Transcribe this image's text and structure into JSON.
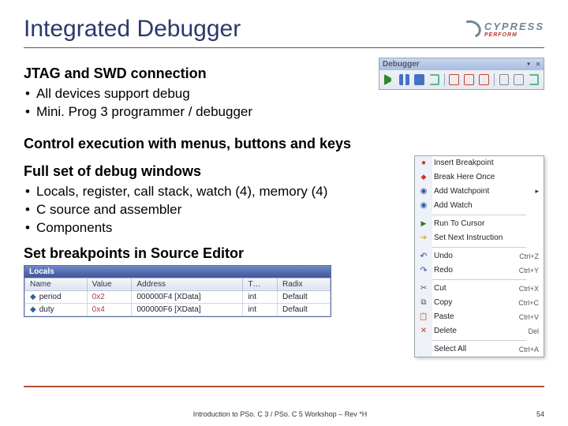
{
  "title": "Integrated Debugger",
  "logo": {
    "text": "CYPRESS",
    "sub": "PERFORM"
  },
  "sec1": {
    "heading": "JTAG and SWD connection",
    "items": [
      "All devices support debug",
      "Mini. Prog 3 programmer / debugger"
    ]
  },
  "toolbar": {
    "caption": "Debugger",
    "close": "▾ ✕"
  },
  "sec2": {
    "heading": "Control execution with menus, buttons and keys"
  },
  "sec3": {
    "heading": "Full set of debug windows",
    "items": [
      "Locals, register, call stack, watch (4), memory (4)",
      "C source and assembler",
      "Components"
    ]
  },
  "sec4": {
    "heading": "Set breakpoints in Source Editor"
  },
  "context_menu": [
    {
      "icon": "dot",
      "label": "Insert Breakpoint",
      "shortcut": "",
      "arrow": false
    },
    {
      "icon": "sq",
      "label": "Break Here Once",
      "shortcut": "",
      "arrow": false
    },
    {
      "icon": "eye",
      "label": "Add Watchpoint",
      "shortcut": "",
      "arrow": true
    },
    {
      "icon": "eye",
      "label": "Add Watch",
      "shortcut": "",
      "arrow": false
    },
    {
      "sep": true
    },
    {
      "icon": "cur",
      "label": "Run To Cursor",
      "shortcut": "",
      "arrow": false
    },
    {
      "icon": "yel",
      "label": "Set Next Instruction",
      "shortcut": "",
      "arrow": false
    },
    {
      "sep": true
    },
    {
      "icon": "und",
      "label": "Undo",
      "shortcut": "Ctrl+Z",
      "arrow": false
    },
    {
      "icon": "red",
      "label": "Redo",
      "shortcut": "Ctrl+Y",
      "arrow": false
    },
    {
      "sep": true
    },
    {
      "icon": "cut",
      "label": "Cut",
      "shortcut": "Ctrl+X",
      "arrow": false
    },
    {
      "icon": "cop",
      "label": "Copy",
      "shortcut": "Ctrl+C",
      "arrow": false
    },
    {
      "icon": "pst",
      "label": "Paste",
      "shortcut": "Ctrl+V",
      "arrow": false
    },
    {
      "icon": "del",
      "label": "Delete",
      "shortcut": "Del",
      "arrow": false
    },
    {
      "sep": true
    },
    {
      "icon": "",
      "label": "Select All",
      "shortcut": "Ctrl+A",
      "arrow": false
    }
  ],
  "locals": {
    "caption": "Locals",
    "cols": [
      "Name",
      "Value",
      "Address",
      "T…",
      "Radix"
    ],
    "rows": [
      {
        "name": "period",
        "value": "0x2",
        "address": "000000F4 [XData]",
        "type": "int",
        "radix": "Default"
      },
      {
        "name": "duty",
        "value": "0x4",
        "address": "000000F6 [XData]",
        "type": "int",
        "radix": "Default"
      }
    ]
  },
  "footer": {
    "center": "Introduction to PSo. C 3 / PSo. C 5 Workshop – Rev *H",
    "page": "54"
  }
}
